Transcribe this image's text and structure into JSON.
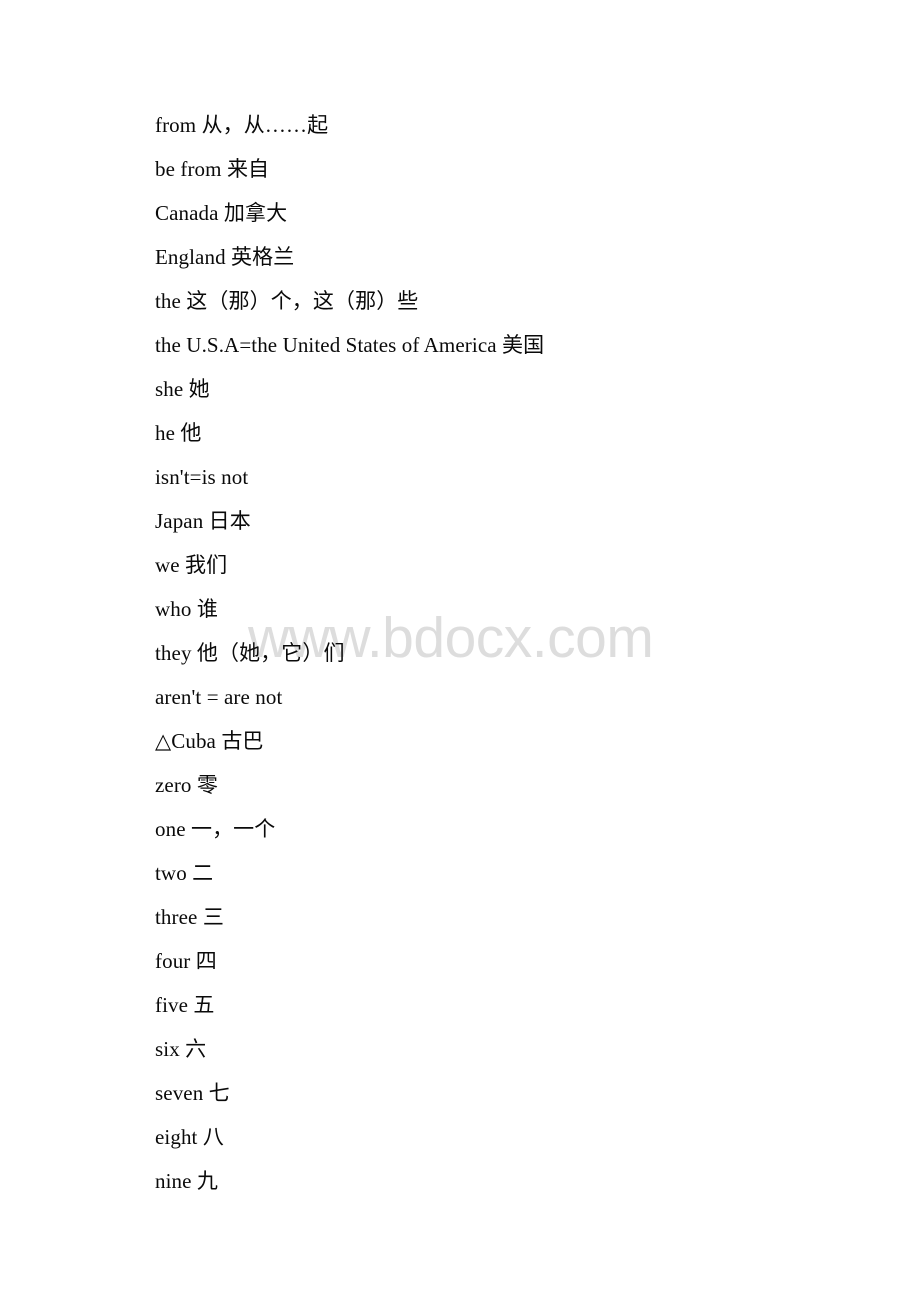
{
  "page": {
    "background_color": "#ffffff",
    "text_color": "#0a0a0a"
  },
  "watermark": {
    "text": "www.bdocx.com",
    "color": "#dddddd"
  },
  "vocabulary": {
    "lines": [
      {
        "text": "from 从，从……起"
      },
      {
        "text": "be from 来自"
      },
      {
        "text": "Canada 加拿大"
      },
      {
        "text": "England 英格兰"
      },
      {
        "text": "the 这（那）个，这（那）些"
      },
      {
        "text": "the U.S.A=the United States of America 美国"
      },
      {
        "text": "she 她"
      },
      {
        "text": "he 他"
      },
      {
        "text": "isn't=is not"
      },
      {
        "text": "Japan 日本"
      },
      {
        "text": "we 我们"
      },
      {
        "text": "who 谁"
      },
      {
        "text": "they 他（她，它）们"
      },
      {
        "text": "aren't = are not"
      },
      {
        "text": "△Cuba 古巴"
      },
      {
        "text": "zero 零"
      },
      {
        "text": "one 一，一个"
      },
      {
        "text": "two 二"
      },
      {
        "text": "three 三"
      },
      {
        "text": "four 四"
      },
      {
        "text": "five 五"
      },
      {
        "text": "six 六"
      },
      {
        "text": "seven 七"
      },
      {
        "text": "eight 八"
      },
      {
        "text": "nine 九"
      }
    ]
  }
}
